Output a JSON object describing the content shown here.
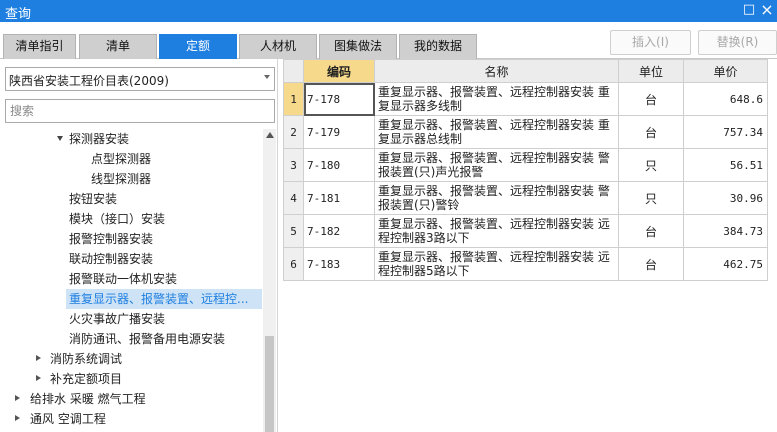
{
  "window": {
    "title": "查询",
    "restore_glyph": "□",
    "close_glyph": "×"
  },
  "tabs": [
    "清单指引",
    "清单",
    "定额",
    "人材机",
    "图集做法",
    "我的数据"
  ],
  "actions": {
    "insert": "插入(I)",
    "replace": "替换(R)"
  },
  "left": {
    "library": "陕西省安装工程价目表(2009)",
    "search_placeholder": "搜索",
    "tree": [
      {
        "label": "探测器安装",
        "toggle": "down"
      },
      {
        "label": "点型探测器",
        "toggle": ""
      },
      {
        "label": "线型探测器",
        "toggle": ""
      },
      {
        "label": "按钮安装",
        "toggle": ""
      },
      {
        "label": "模块（接口）安装",
        "toggle": ""
      },
      {
        "label": "报警控制器安装",
        "toggle": ""
      },
      {
        "label": "联动控制器安装",
        "toggle": ""
      },
      {
        "label": "报警联动一体机安装",
        "toggle": ""
      },
      {
        "label": "重复显示器、报警装置、远程控...",
        "toggle": "",
        "selected": true
      },
      {
        "label": "火灾事故广播安装",
        "toggle": ""
      },
      {
        "label": "消防通讯、报警备用电源安装",
        "toggle": ""
      },
      {
        "label": "消防系统调试",
        "toggle": "right"
      },
      {
        "label": "补充定额项目",
        "toggle": "right"
      },
      {
        "label": "给排水 采暖 燃气工程",
        "toggle": "right"
      },
      {
        "label": "通风 空调工程",
        "toggle": "right"
      }
    ]
  },
  "table": {
    "headers": {
      "code": "编码",
      "name": "名称",
      "unit": "单位",
      "price": "单价"
    },
    "rows": [
      {
        "num": "1",
        "code": "7-178",
        "name": "重复显示器、报警装置、远程控制器安装 重复显示器多线制",
        "unit": "台",
        "price": "648.6"
      },
      {
        "num": "2",
        "code": "7-179",
        "name": "重复显示器、报警装置、远程控制器安装 重复显示器总线制",
        "unit": "台",
        "price": "757.34"
      },
      {
        "num": "3",
        "code": "7-180",
        "name": "重复显示器、报警装置、远程控制器安装 警报装置(只)声光报警",
        "unit": "只",
        "price": "56.51"
      },
      {
        "num": "4",
        "code": "7-181",
        "name": "重复显示器、报警装置、远程控制器安装 警报装置(只)警铃",
        "unit": "只",
        "price": "30.96"
      },
      {
        "num": "5",
        "code": "7-182",
        "name": "重复显示器、报警装置、远程控制器安装 远程控制器3路以下",
        "unit": "台",
        "price": "384.73"
      },
      {
        "num": "6",
        "code": "7-183",
        "name": "重复显示器、报警装置、远程控制器安装 远程控制器5路以下",
        "unit": "台",
        "price": "462.75"
      }
    ]
  }
}
